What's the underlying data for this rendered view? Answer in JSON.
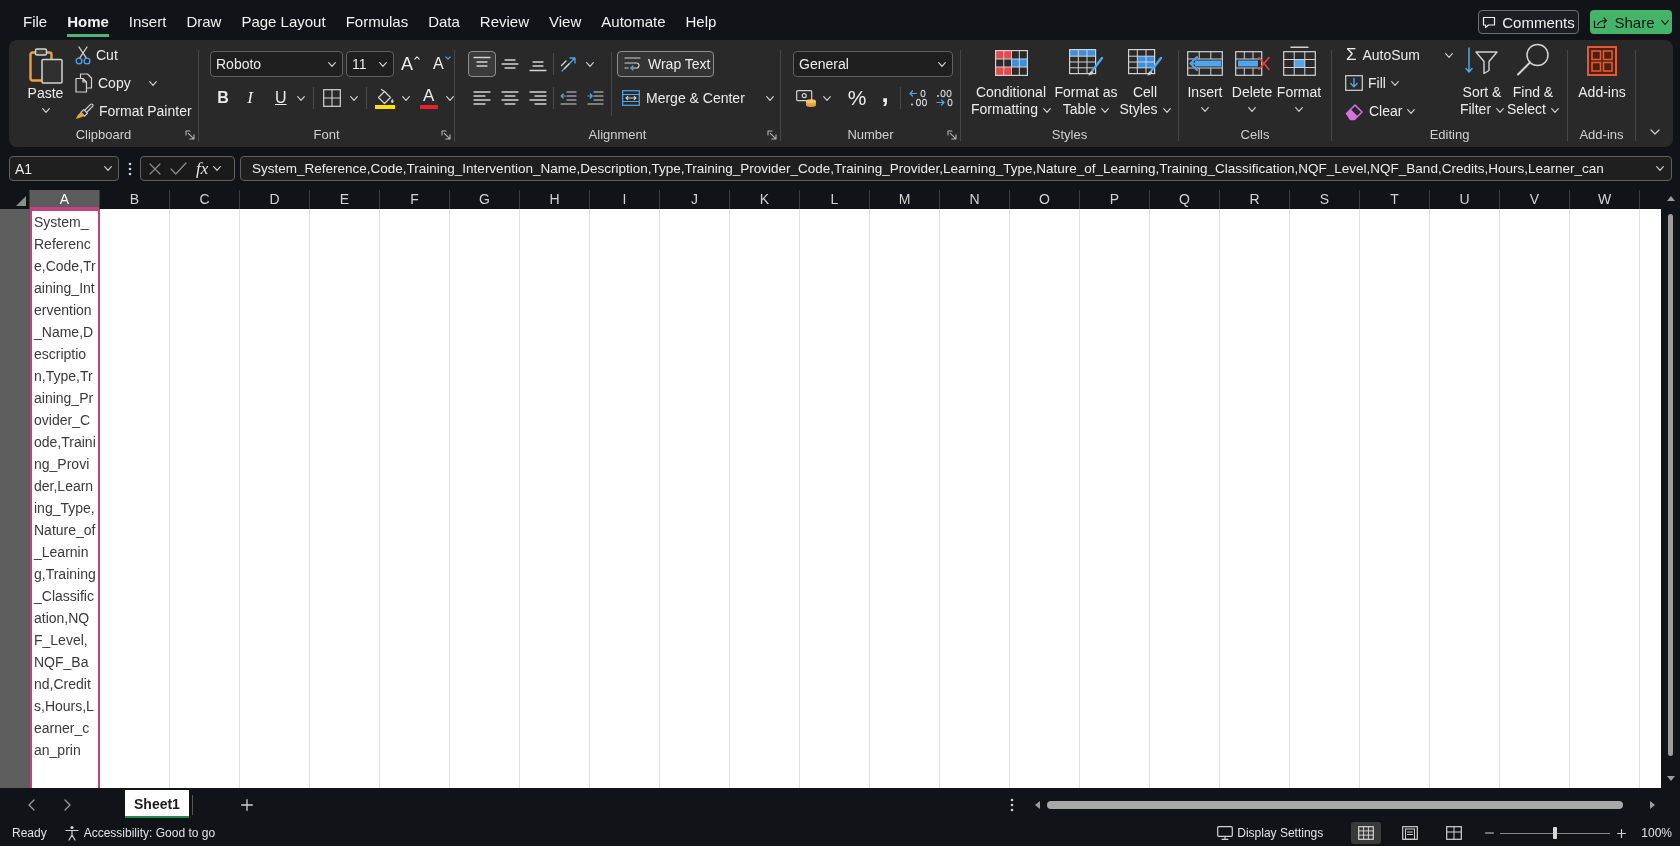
{
  "menu_tabs": [
    {
      "label": "File",
      "selected": false
    },
    {
      "label": "Home",
      "selected": true
    },
    {
      "label": "Insert",
      "selected": false
    },
    {
      "label": "Draw",
      "selected": false
    },
    {
      "label": "Page Layout",
      "selected": false
    },
    {
      "label": "Formulas",
      "selected": false
    },
    {
      "label": "Data",
      "selected": false
    },
    {
      "label": "Review",
      "selected": false
    },
    {
      "label": "View",
      "selected": false
    },
    {
      "label": "Automate",
      "selected": false
    },
    {
      "label": "Help",
      "selected": false
    }
  ],
  "header_buttons": [
    {
      "label": "Comments",
      "kind": "comments"
    },
    {
      "label": "Share",
      "kind": "share"
    }
  ],
  "ribbon": {
    "clipboard": {
      "label": "Clipboard",
      "paste": "Paste",
      "cut": "Cut",
      "copy": "Copy",
      "format_painter": "Format Painter"
    },
    "font": {
      "label": "Font",
      "font_name": "Roboto",
      "font_size": "11",
      "grow_font": "A",
      "shrink_font": "A",
      "bold": "B",
      "italic": "I",
      "underline": "U",
      "font_color": "A"
    },
    "alignment": {
      "label": "Alignment",
      "vertical": [
        {
          "kind": "top",
          "selected": true
        },
        {
          "kind": "middle",
          "selected": false
        },
        {
          "kind": "bottom",
          "selected": false
        }
      ],
      "horizontal": [
        {
          "kind": "left",
          "selected": false
        },
        {
          "kind": "center",
          "selected": false
        },
        {
          "kind": "right",
          "selected": false
        }
      ],
      "wrap_text": {
        "label": "Wrap Text",
        "on": true
      },
      "merge": "Merge & Center"
    },
    "number": {
      "label": "Number",
      "format": "General",
      "percent": "%",
      "comma": ","
    },
    "styles": {
      "label": "Styles",
      "buttons": [
        {
          "label": "Conditional Formatting",
          "kind": "conditional"
        },
        {
          "label": "Format as Table",
          "kind": "table"
        },
        {
          "label": "Cell Styles",
          "kind": "cell_styles"
        }
      ]
    },
    "cells": {
      "label": "Cells",
      "buttons": [
        {
          "label": "Insert",
          "kind": "insert"
        },
        {
          "label": "Delete",
          "kind": "delete"
        },
        {
          "label": "Format",
          "kind": "format"
        }
      ]
    },
    "editing": {
      "label": "Editing",
      "sum_symbol": "Σ",
      "autosum": "AutoSum",
      "fill": "Fill",
      "clear": "Clear",
      "buttons": [
        {
          "label": "Sort & Filter",
          "kind": "sort"
        },
        {
          "label": "Find & Select",
          "kind": "find"
        }
      ]
    },
    "addins": {
      "label": "Add-ins",
      "button": "Add-ins"
    }
  },
  "formula_bar": {
    "name_box": "A1",
    "function_label": "fx",
    "content": "System_Reference,Code,Training_Intervention_Name,Description,Type,Training_Provider_Code,Training_Provider,Learning_Type,Nature_of_Learning,Training_Classification,NQF_Level,NQF_Band,Credits,Hours,Learner_can"
  },
  "sheet": {
    "columns": [
      {
        "label": "A",
        "selected": true
      },
      {
        "label": "B",
        "selected": false
      },
      {
        "label": "C",
        "selected": false
      },
      {
        "label": "D",
        "selected": false
      },
      {
        "label": "E",
        "selected": false
      },
      {
        "label": "F",
        "selected": false
      },
      {
        "label": "G",
        "selected": false
      },
      {
        "label": "H",
        "selected": false
      },
      {
        "label": "I",
        "selected": false
      },
      {
        "label": "J",
        "selected": false
      },
      {
        "label": "K",
        "selected": false
      },
      {
        "label": "L",
        "selected": false
      },
      {
        "label": "M",
        "selected": false
      },
      {
        "label": "N",
        "selected": false
      },
      {
        "label": "O",
        "selected": false
      },
      {
        "label": "P",
        "selected": false
      },
      {
        "label": "Q",
        "selected": false
      },
      {
        "label": "R",
        "selected": false
      },
      {
        "label": "S",
        "selected": false
      },
      {
        "label": "T",
        "selected": false
      },
      {
        "label": "U",
        "selected": false
      },
      {
        "label": "V",
        "selected": false
      },
      {
        "label": "W",
        "selected": false
      }
    ],
    "row_header": {
      "selected": true
    },
    "cell": {
      "text": "System_Reference,Code,Training_Intervention_Name,Description,Type,Training_Provider_Code,Training_Provider,Learning_Type,Nature_of_Learning,Training_Classification,NQF_Level,NQF_Band,Credits,Hours,Learner_can_prin",
      "selected": true
    }
  },
  "sheet_tabs": [
    {
      "label": "Sheet1",
      "selected": true
    }
  ],
  "status_bar": {
    "mode": "Ready",
    "accessibility": "Accessibility: Good to go",
    "display_settings": "Display Settings",
    "views": [
      {
        "kind": "normal",
        "selected": true
      },
      {
        "kind": "page_layout",
        "selected": false
      },
      {
        "kind": "page_break",
        "selected": false
      }
    ],
    "zoom": {
      "level": 0.5,
      "reading": "100%"
    }
  }
}
